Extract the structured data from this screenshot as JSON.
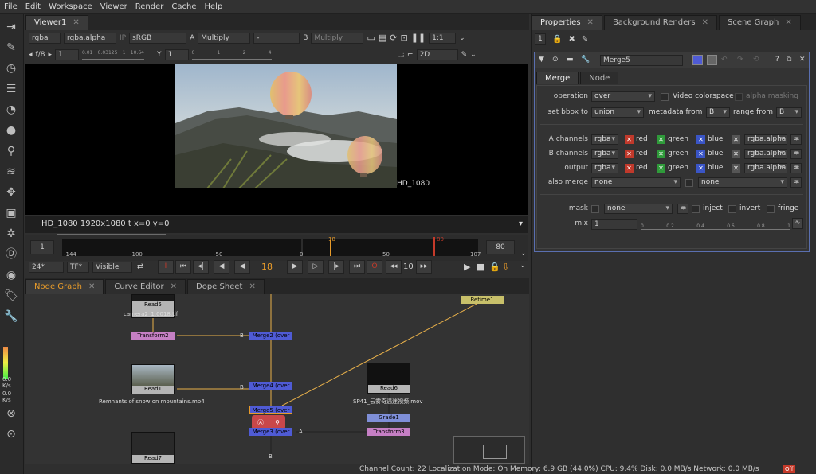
{
  "menu": [
    "File",
    "Edit",
    "Workspace",
    "Viewer",
    "Render",
    "Cache",
    "Help"
  ],
  "viewer": {
    "tab": "Viewer1",
    "channels": "rgba",
    "alpha": "rgba.alpha",
    "ip": "IP",
    "colorspace": "sRGB",
    "a_label": "A",
    "a_mode": "Multiply",
    "a_input": "-",
    "b_label": "B",
    "b_mode": "Multiply",
    "zoom": "1:1",
    "fstop": "f/8",
    "f_value": "1",
    "gain_ticks": [
      "0.01",
      "0.03125",
      "1",
      "10.64"
    ],
    "y_label": "Y",
    "y_value": "1",
    "y_ticks": [
      "0",
      "1",
      "2",
      "4"
    ],
    "view_mode": "2D",
    "format_label": "HD_1080",
    "info": "HD_1080 1920x1080  t  x=0 y=0"
  },
  "timeline": {
    "start": "1",
    "end": "80",
    "ticks": [
      "-144",
      "-100",
      "-50",
      "0",
      "18",
      "50",
      "80",
      "107"
    ],
    "current_frame": "18",
    "fps": "24*",
    "tf": "TF*",
    "visible": "Visible",
    "frame_display": "18",
    "step": "10"
  },
  "node_tabs": [
    "Node Graph",
    "Curve Editor",
    "Dope Sheet"
  ],
  "nodes": {
    "read5": "Read5",
    "read5_file": "camera2_1.0018.tif",
    "transform2": "Transform2",
    "merge2": "Merge2 (over",
    "retime1": "Retime1",
    "read1": "Read1",
    "read1_file": "Remnants of snow on mountains.mp4",
    "merge4": "Merge4 (over",
    "read6": "Read6",
    "read6_file": "SP41_云雾奇遇迷视频.mov",
    "merge5": "Merge5 (over",
    "grade1": "Grade1",
    "merge3": "Merge3 (over",
    "transform3": "Transform3",
    "read7": "Read7",
    "input_b": "B",
    "input_a": "A",
    "input_b2": "B",
    "input_b3": "B"
  },
  "left_readouts": [
    "0.0",
    "0.0",
    "K/s",
    "K/s"
  ],
  "panel": {
    "tabs": [
      "Properties",
      "Background Renders",
      "Scene Graph"
    ],
    "count": "1",
    "node_name": "Merge5",
    "subtabs": [
      "Merge",
      "Node"
    ],
    "operation_label": "operation",
    "operation": "over",
    "video_colorspace": "Video colorspace",
    "alpha_masking": "alpha masking",
    "bbox_label": "set bbox to",
    "bbox": "union",
    "metadata_label": "metadata from",
    "metadata": "B",
    "range_label": "range from",
    "range": "B",
    "channel_rows": [
      {
        "label": "A channels",
        "layer": "rgba",
        "r": "red",
        "g": "green",
        "b": "blue",
        "alpha": "rgba.alpha"
      },
      {
        "label": "B channels",
        "layer": "rgba",
        "r": "red",
        "g": "green",
        "b": "blue",
        "alpha": "rgba.alpha"
      },
      {
        "label": "output",
        "layer": "rgba",
        "r": "red",
        "g": "green",
        "b": "blue",
        "alpha": "rgba.alpha"
      }
    ],
    "also_merge_label": "also merge",
    "also_merge": "none",
    "also_merge2": "none",
    "mask_label": "mask",
    "mask": "none",
    "inject": "inject",
    "invert": "invert",
    "fringe": "fringe",
    "mix_label": "mix",
    "mix": "1",
    "mix_ticks": [
      "0",
      "0.2",
      "0.4",
      "0.6",
      "0.8",
      "1"
    ]
  },
  "status": "Channel Count: 22  Localization Mode: On  Memory: 6.9 GB (44.0%)  CPU: 9.4%  Disk: 0.0 MB/s  Network: 0.0 MB/s",
  "status_badge": "Off",
  "colors": {
    "accent": "#e89b2a",
    "merge_node": "#4f5bd5",
    "transform_node": "#c57fc4",
    "retime_node": "#c8c06a",
    "grade_node": "#7f8fd8",
    "selection": "#5a6fb0"
  }
}
